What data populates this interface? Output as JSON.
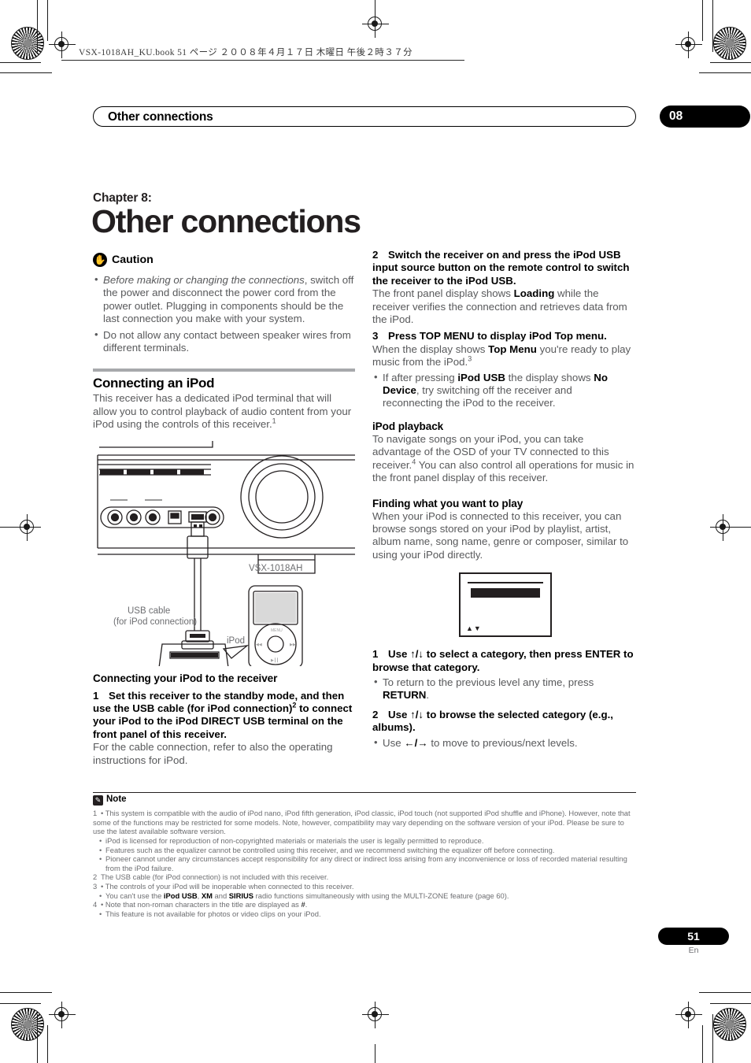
{
  "print_header": "VSX-1018AH_KU.book   51 ページ   ２００８年４月１７日   木曜日   午後２時３７分",
  "running_head": "Other connections",
  "chapter_badge": "08",
  "chapter_eyebrow": "Chapter 8:",
  "chapter_title": "Other connections",
  "caution": {
    "title": "Caution",
    "icon": "hand-icon",
    "items": [
      "Before making or changing the connections, switch off the power and disconnect the power cord from the power outlet. Plugging in components should be the last connection you make with your system.",
      "Do not allow any contact between speaker wires from different terminals."
    ],
    "item1_italic_lead": "Before making or changing the connections",
    "item1_rest": ", switch off the power and disconnect the power cord from the power outlet. Plugging in components should be the last connection you make with your system."
  },
  "connecting_ipod": {
    "heading": "Connecting an iPod",
    "intro": "This receiver has a dedicated iPod terminal that will allow you to control playback of audio content from your iPod using the controls of this receiver.",
    "intro_footnote": "1"
  },
  "figure": {
    "receiver_label": "VSX-1018AH",
    "cable_label_line1": "USB cable",
    "cable_label_line2": "(for iPod connection)",
    "ipod_label": "iPod"
  },
  "connecting_receiver": {
    "heading": "Connecting your iPod to the receiver",
    "step1_num": "1",
    "step1_a": "Set this receiver to the standby mode, and then use the USB cable (for iPod connection)",
    "step1_footnote": "2",
    "step1_b": " to connect your iPod to the iPod DIRECT USB terminal on the front panel of this receiver.",
    "step1_body": "For the cable connection, refer to also the operating instructions for iPod."
  },
  "step2": {
    "num": "2",
    "head": "Switch the receiver on and press the iPod USB input source button on the remote control to switch the receiver to the iPod USB.",
    "body_a": "The front panel display shows ",
    "body_bold": "Loading",
    "body_b": " while the receiver verifies the connection and retrieves data from the iPod."
  },
  "step3": {
    "num": "3",
    "head": "Press TOP MENU to display iPod Top menu.",
    "body_a": "When the display shows ",
    "body_bold": "Top Menu",
    "body_b": " you're ready to play music from the iPod.",
    "body_footnote": "3",
    "bullet_a": "If after pressing ",
    "bullet_bold1": "iPod USB",
    "bullet_b": " the display shows ",
    "bullet_bold2": "No Device",
    "bullet_c": ", try switching off the receiver and reconnecting the iPod to the receiver."
  },
  "ipod_playback": {
    "heading": "iPod playback",
    "body_a": "To navigate songs on your iPod, you can take advantage of the OSD of your TV connected to this receiver.",
    "body_footnote": "4",
    "body_b": " You can also control all operations for music in the front panel display of this receiver."
  },
  "finding": {
    "heading": "Finding what you want to play",
    "body": "When your iPod is connected to this receiver, you can browse songs stored on your iPod by playlist, artist, album name, song name, genre or composer, similar to using your iPod directly."
  },
  "osd": {
    "arrows": "▲▼"
  },
  "nav_steps": {
    "step1_num": "1",
    "step1_head_a": "Use ",
    "step1_arrows": "↑/↓",
    "step1_head_b": " to select a category, then press ENTER to browse that category.",
    "step1_bullet_a": "To return to the previous level any time, press ",
    "step1_bullet_bold": "RETURN",
    "step1_bullet_b": ".",
    "step2_num": "2",
    "step2_head_a": "Use ",
    "step2_arrows": "↑/↓",
    "step2_head_b": " to browse the selected category (e.g., albums).",
    "step2_bullet_a": "Use ",
    "step2_bullet_arrows": "←/→",
    "step2_bullet_b": " to move to previous/next levels."
  },
  "notes": {
    "title": "Note",
    "icon": "note-pencil-icon",
    "n1_num": "1",
    "n1_main": "This system is compatible with the audio of iPod nano, iPod fifth generation, iPod classic, iPod touch (not supported iPod shuffle and iPhone). However, note that some of the functions may be restricted for some models. Note, however, compatibility may vary depending on the software version of your iPod. Please be sure to use the latest available software version.",
    "n1_sub1": "iPod is licensed for reproduction of non-copyrighted materials or materials the user is legally permitted to reproduce.",
    "n1_sub2": "Features such as the equalizer cannot be controlled using this receiver, and we recommend switching the equalizer off before connecting.",
    "n1_sub3": "Pioneer cannot under any circumstances accept responsibility for any direct or indirect loss arising from any inconvenience or loss of recorded material resulting from the iPod failure.",
    "n2_num": "2",
    "n2_main": "The USB cable (for iPod connection) is not included with this receiver.",
    "n3_num": "3",
    "n3_sub1": "The controls of your iPod will be inoperable when connected to this receiver.",
    "n3_sub2_a": "You can't use the ",
    "n3_sub2_b1": "iPod USB",
    "n3_sub2_c": ", ",
    "n3_sub2_b2": "XM",
    "n3_sub2_d": " and ",
    "n3_sub2_b3": "SIRIUS",
    "n3_sub2_e": " radio functions simultaneously with using the MULTI-ZONE feature (page 60).",
    "n4_num": "4",
    "n4_sub1_a": "Note that non-roman characters in the title are displayed as ",
    "n4_sub1_b": "#",
    "n4_sub1_c": ".",
    "n4_sub2": "This feature is not available for photos or video clips on your iPod."
  },
  "footer": {
    "page_number": "51",
    "language": "En"
  },
  "colors": {
    "ink": "#231f20",
    "body_gray": "#58595b",
    "rule_gray": "#a7a9ac",
    "footnote_gray": "#6d6e71"
  }
}
